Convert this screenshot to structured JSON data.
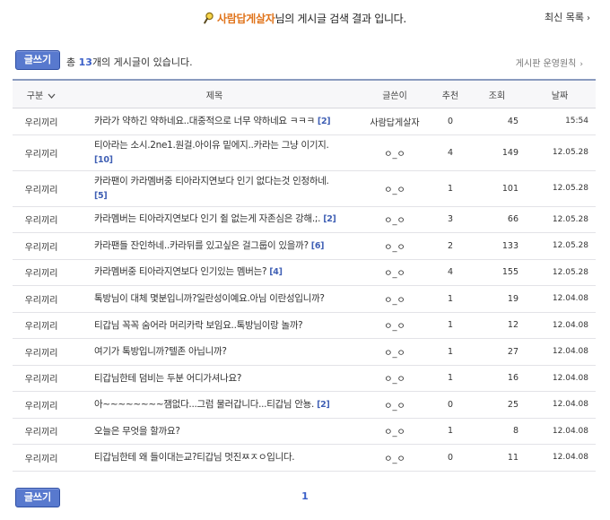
{
  "header": {
    "nickname": "사람답게살자",
    "title_suffix": "님의 게시글 검색 결과 입니다.",
    "latest_link": "최신 목록"
  },
  "toolbar": {
    "write_label": "글쓰기",
    "count_prefix": "총",
    "count_value": "13",
    "count_suffix": "개의 게시글이 있습니다.",
    "policy_link": "게시판 운영원칙"
  },
  "columns": {
    "category": "구분",
    "title": "제목",
    "author": "글쓴이",
    "recommend": "추천",
    "views": "조회",
    "date": "날짜"
  },
  "rows": [
    {
      "category": "우리끼리",
      "title": "카라가 약하긴 약하네요..대중적으로 너무 약하네요 ㅋㅋㅋ",
      "comments": "[2]",
      "author": "사람답게살자",
      "recommend": "0",
      "views": "45",
      "date": "15:54"
    },
    {
      "category": "우리끼리",
      "title": "티아라는 소시.2ne1.원걸.아이유 밑에지..카라는 그냥 이기지.",
      "comments": "[10]",
      "author": "ㅇ_ㅇ",
      "recommend": "4",
      "views": "149",
      "date": "12.05.28"
    },
    {
      "category": "우리끼리",
      "title": "카라팬이 카라멤버중 티아라지연보다 인기 없다는것 인정하네.",
      "comments": "[5]",
      "author": "ㅇ_ㅇ",
      "recommend": "1",
      "views": "101",
      "date": "12.05.28"
    },
    {
      "category": "우리끼리",
      "title": "카라멤버는 티아라지연보다 인기 쥘 없는게 자존심은 강해.;.",
      "comments": "[2]",
      "author": "ㅇ_ㅇ",
      "recommend": "3",
      "views": "66",
      "date": "12.05.28"
    },
    {
      "category": "우리끼리",
      "title": "카라팬들 잔인하네..카라뒤를 있고싶은 걸그룹이 있을까?",
      "comments": "[6]",
      "author": "ㅇ_ㅇ",
      "recommend": "2",
      "views": "133",
      "date": "12.05.28"
    },
    {
      "category": "우리끼리",
      "title": "카라멤버중 티아라지연보다 인기있는 멤버는?",
      "comments": "[4]",
      "author": "ㅇ_ㅇ",
      "recommend": "4",
      "views": "155",
      "date": "12.05.28"
    },
    {
      "category": "우리끼리",
      "title": "톡방님이 대체 몇분입니까?일란성이예요.아님 이란성입니까?",
      "comments": "",
      "author": "ㅇ_ㅇ",
      "recommend": "1",
      "views": "19",
      "date": "12.04.08"
    },
    {
      "category": "우리끼리",
      "title": "티갑님 꼭꼭 숨어라 머리카락 보임요..톡방님이랑 놀까?",
      "comments": "",
      "author": "ㅇ_ㅇ",
      "recommend": "1",
      "views": "12",
      "date": "12.04.08"
    },
    {
      "category": "우리끼리",
      "title": "여기가 톡방입니까?텔존 아닙니까?",
      "comments": "",
      "author": "ㅇ_ㅇ",
      "recommend": "1",
      "views": "27",
      "date": "12.04.08"
    },
    {
      "category": "우리끼리",
      "title": "티갑님한테 덤비는 두분 어디가셔나요?",
      "comments": "",
      "author": "ㅇ_ㅇ",
      "recommend": "1",
      "views": "16",
      "date": "12.04.08"
    },
    {
      "category": "우리끼리",
      "title": "아~~~~~~~~잼없다...그럼 물러갑니다...티갑님 안뇽.",
      "comments": "[2]",
      "author": "ㅇ_ㅇ",
      "recommend": "0",
      "views": "25",
      "date": "12.04.08"
    },
    {
      "category": "우리끼리",
      "title": "오늘은 무엇을 할까요?",
      "comments": "",
      "author": "ㅇ_ㅇ",
      "recommend": "1",
      "views": "8",
      "date": "12.04.08"
    },
    {
      "category": "우리끼리",
      "title": "티갑님한테 왜 들이대는교?티갑님 멋진ㅉㅈㅇ입니다.",
      "comments": "",
      "author": "ㅇ_ㅇ",
      "recommend": "0",
      "views": "11",
      "date": "12.04.08"
    }
  ],
  "pagination": {
    "pages": [
      "1"
    ]
  },
  "colors": {
    "accent": "#e0731a",
    "link_blue": "#3a5fc8",
    "button": "#5879ce"
  }
}
